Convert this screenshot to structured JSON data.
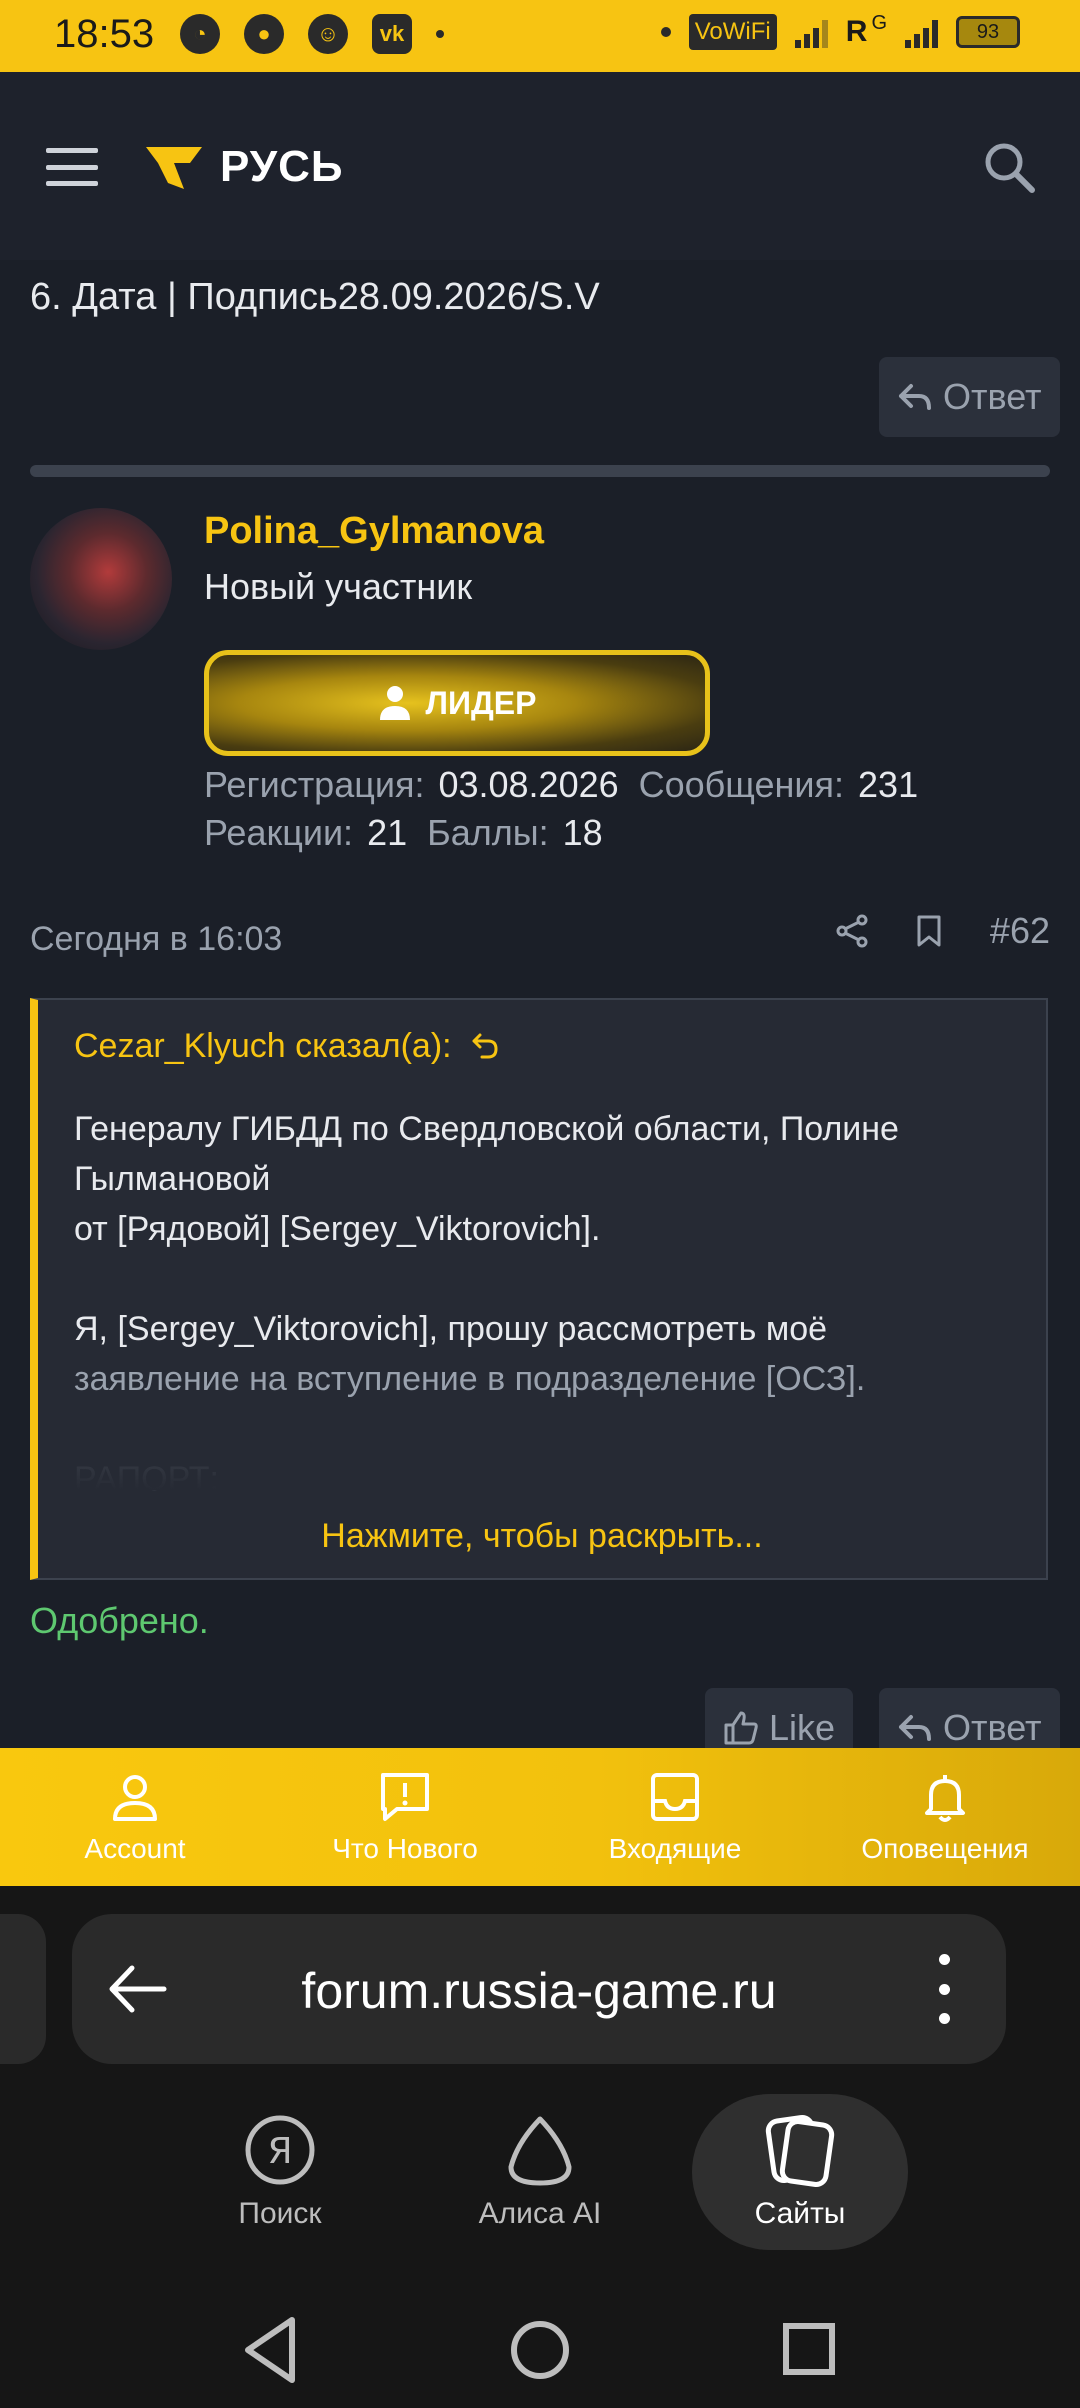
{
  "status_bar": {
    "time": "18:53",
    "network_label": "VoWiFi",
    "roaming": "R",
    "network_type": "G",
    "battery": "93"
  },
  "header": {
    "logo_text": "РУСЬ",
    "accent_color": "#f7c412"
  },
  "previous_post": {
    "signature_line": "6. Дата | Подпись28.09.2026/S.V",
    "reply_label": "Ответ"
  },
  "post": {
    "author": "Polina_Gylmanova",
    "author_title": "Новый участник",
    "badge": "ЛИДЕР",
    "stats": {
      "registration_label": "Регистрация:",
      "registration_value": "03.08.2026",
      "messages_label": "Сообщения:",
      "messages_value": "231",
      "reactions_label": "Реакции:",
      "reactions_value": "21",
      "points_label": "Баллы:",
      "points_value": "18"
    },
    "time": "Сегодня в 16:03",
    "number": "#62",
    "quote": {
      "author_line": "Cezar_Klyuch сказал(а):",
      "line1": "Генералу ГИБДД по Свердловской области, Полине Гылмановой",
      "line2": "от [Рядовой] [Sergey_Viktorovich].",
      "line3": "Я, [Sergey_Viktorovich], прошу рассмотреть моё",
      "line4": "заявление на вступление в подразделение [ОСЗ].",
      "line5": "РАПОРТ:",
      "expand": "Нажмите, чтобы раскрыть..."
    },
    "body": "Одобрено.",
    "like_label": "Like",
    "reply_label": "Ответ"
  },
  "bottom_nav": {
    "items": [
      {
        "label": "Account",
        "icon": "account-icon"
      },
      {
        "label": "Что Нового",
        "icon": "whats-new-icon"
      },
      {
        "label": "Входящие",
        "icon": "inbox-icon"
      },
      {
        "label": "Оповещения",
        "icon": "bell-icon"
      }
    ]
  },
  "browser": {
    "url": "forum.russia-game.ru",
    "dock": [
      {
        "label": "Поиск",
        "icon": "yandex-search-icon"
      },
      {
        "label": "Алиса AI",
        "icon": "alice-icon"
      },
      {
        "label": "Сайты",
        "icon": "sites-icon"
      }
    ]
  }
}
